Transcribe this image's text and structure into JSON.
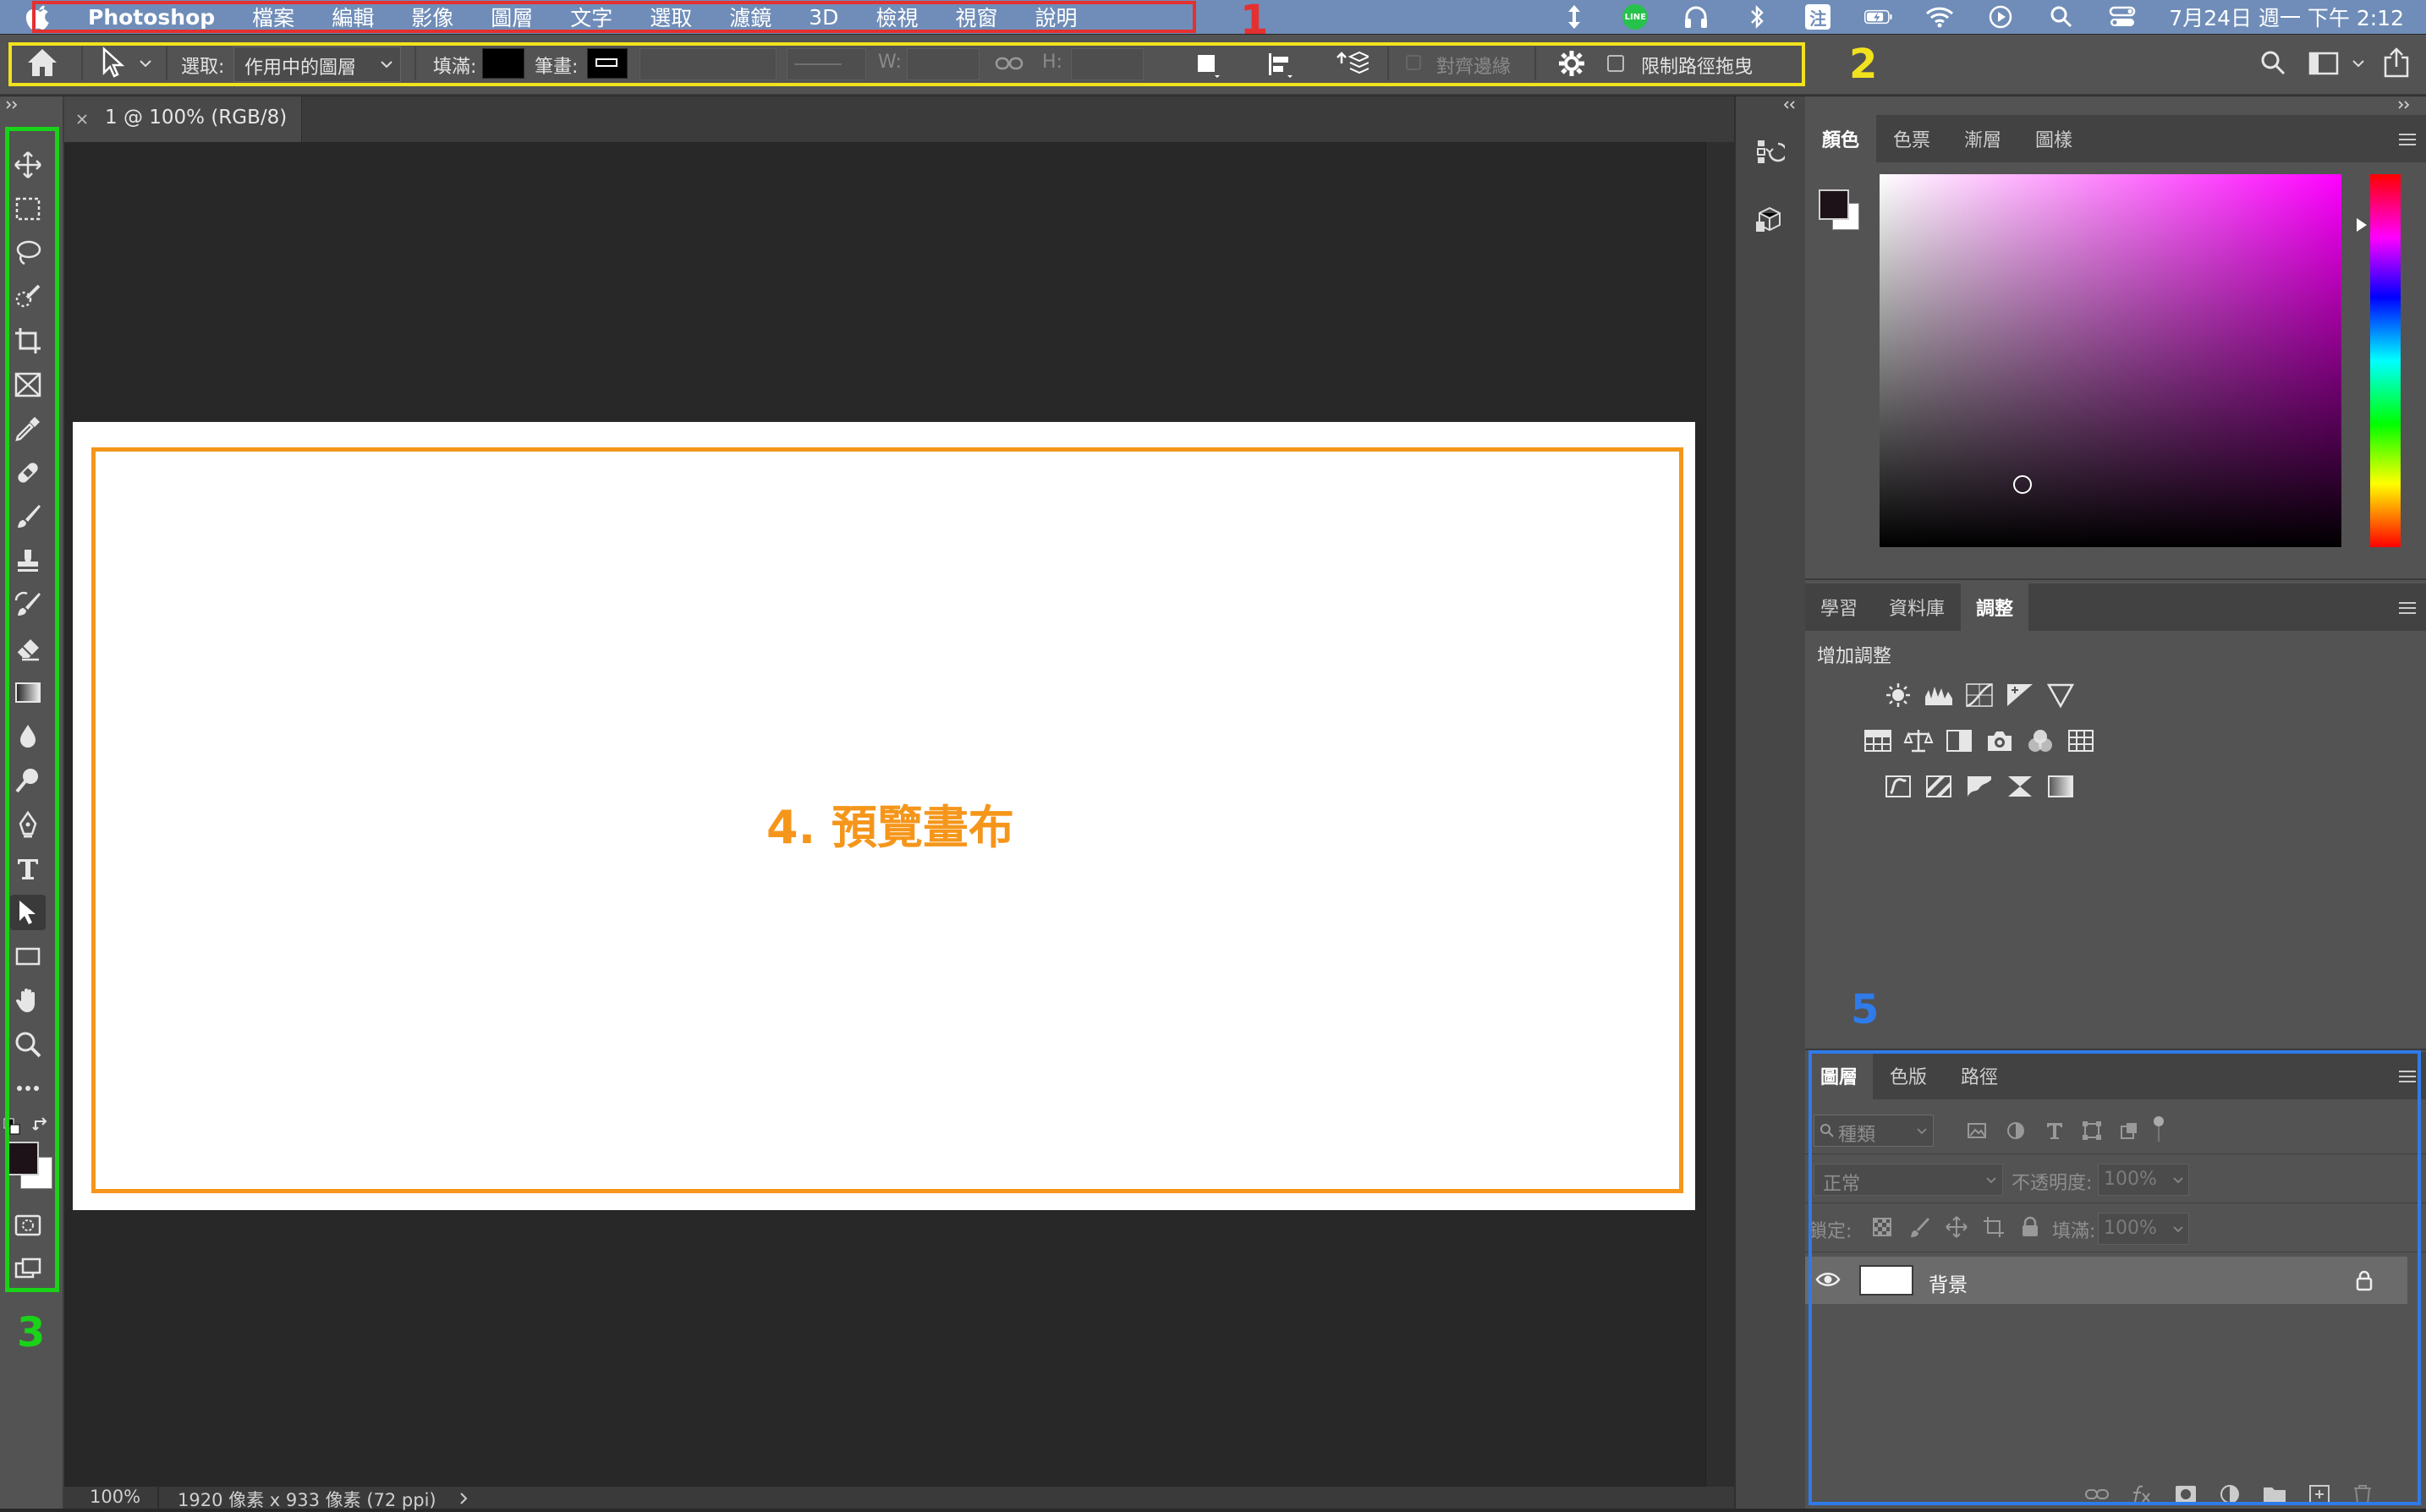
{
  "menubar": {
    "app_name": "Photoshop",
    "items": [
      "檔案",
      "編輯",
      "影像",
      "圖層",
      "文字",
      "選取",
      "濾鏡",
      "3D",
      "檢視",
      "視窗",
      "說明"
    ],
    "status_icons": [
      "arrows-updown-icon",
      "line-app-icon",
      "headphones-icon",
      "bluetooth-icon",
      "input-method-icon",
      "battery-icon",
      "wifi-icon",
      "play-circle-icon",
      "spotlight-search-icon",
      "control-center-icon"
    ],
    "line_label": "LINE",
    "ime_label": "注",
    "clock": "7月24日 週一 下午 2:12"
  },
  "options_bar": {
    "select_label": "選取:",
    "select_value": "作用中的圖層",
    "fill_label": "填滿:",
    "stroke_label": "筆畫:",
    "w_label": "W:",
    "h_label": "H:",
    "align_edges_label": "對齊邊緣",
    "constrain_path_label": "限制路徑拖曳"
  },
  "document": {
    "tab_title": "1 @ 100% (RGB/8)",
    "zoom": "100%",
    "doc_info": "1920 像素 x 933 像素 (72 ppi)"
  },
  "color_panel": {
    "tabs": [
      "顏色",
      "色票",
      "漸層",
      "圖樣"
    ],
    "active_tab": "顏色"
  },
  "adjust_panel": {
    "tabs": [
      "學習",
      "資料庫",
      "調整"
    ],
    "active_tab": "調整",
    "heading": "增加調整"
  },
  "layers_panel": {
    "tabs": [
      "圖層",
      "色版",
      "路徑"
    ],
    "active_tab": "圖層",
    "filter_placeholder": "種類",
    "blend_mode": "正常",
    "opacity_label": "不透明度:",
    "opacity_value": "100%",
    "lock_label": "鎖定:",
    "fill_label": "填滿:",
    "fill_value": "100%",
    "layers": [
      {
        "name": "背景"
      }
    ]
  },
  "annotations": {
    "label_1": "1",
    "label_2": "2",
    "label_3": "3",
    "label_4": "4. 預覽畫布",
    "label_5": "5",
    "colors": {
      "menu": "#e53030",
      "options": "#f2e21d",
      "tools": "#19d219",
      "canvas": "#f5961b",
      "panels": "#2f7bea"
    }
  }
}
